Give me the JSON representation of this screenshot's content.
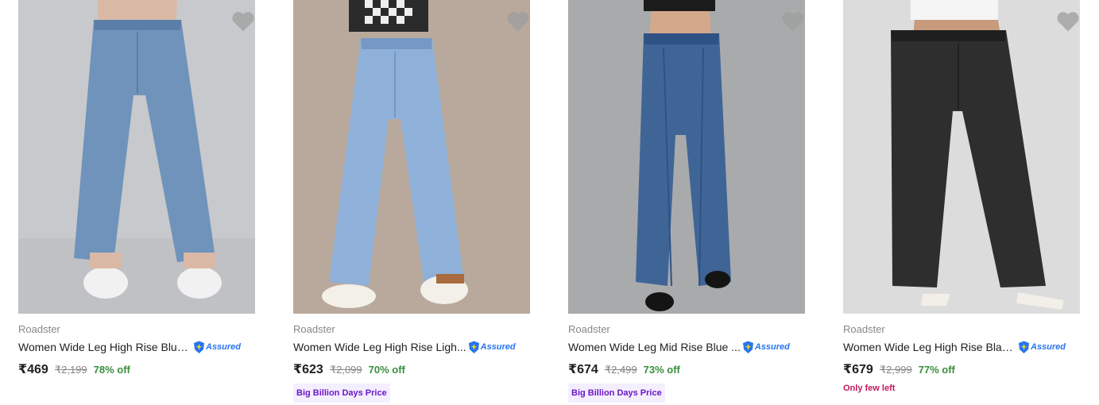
{
  "products": [
    {
      "brand": "Roadster",
      "title": "Women Wide Leg High Rise Blue...",
      "assured_label": "Assured",
      "price": "₹469",
      "mrp": "₹2,199",
      "discount": "78% off",
      "image_colors": {
        "bg": "#c7c9cc",
        "jeans": "#6f93bb",
        "jeans_dark": "#5a7ea8",
        "shoe": "#f1f1f1"
      }
    },
    {
      "brand": "Roadster",
      "title": "Women Wide Leg High Rise Ligh...",
      "assured_label": "Assured",
      "price": "₹623",
      "mrp": "₹2,099",
      "discount": "70% off",
      "badge": "Big Billion Days Price",
      "image_colors": {
        "bg": "#b9a99c",
        "jeans": "#8fb1d9",
        "jeans_dark": "#7599c4",
        "shoe": "#f3efe9"
      }
    },
    {
      "brand": "Roadster",
      "title": "Women Wide Leg Mid Rise Blue ...",
      "assured_label": "Assured",
      "price": "₹674",
      "mrp": "₹2,499",
      "discount": "73% off",
      "badge": "Big Billion Days Price",
      "image_colors": {
        "bg": "#a8aaac",
        "jeans": "#3f6596",
        "jeans_dark": "#2f5284",
        "shoe": "#141414"
      }
    },
    {
      "brand": "Roadster",
      "title": "Women Wide Leg High Rise Blac...",
      "assured_label": "Assured",
      "price": "₹679",
      "mrp": "₹2,999",
      "discount": "77% off",
      "stock_note": "Only few left",
      "image_colors": {
        "bg": "#dcdcdc",
        "jeans": "#2e2e2e",
        "jeans_dark": "#1f1f1f",
        "shoe": "#f2eee8"
      }
    }
  ],
  "icons": {
    "wishlist": "heart-icon",
    "assured": "shield-plus-icon"
  },
  "colors": {
    "price_discount": "#388e3c",
    "assured_blue": "#2874f0",
    "badge_purple": "#6b17c7",
    "stock_red": "#c2185b"
  }
}
